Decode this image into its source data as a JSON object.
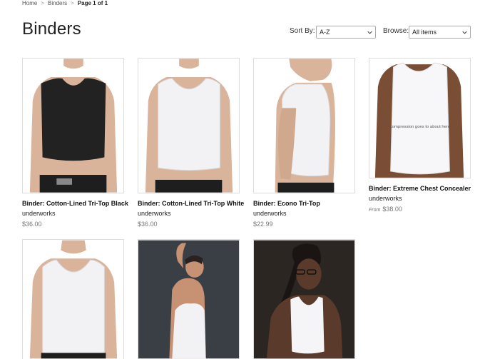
{
  "breadcrumb": {
    "home": "Home",
    "sep": ">",
    "section": "Binders",
    "page": "Page 1 of 1"
  },
  "page_title": "Binders",
  "sort": {
    "label": "Sort By:",
    "value": "A-Z"
  },
  "browse": {
    "label": "Browse:",
    "value": "All items"
  },
  "products": [
    {
      "name": "Binder: Cotton-Lined Tri-Top Black",
      "brand": "underworks",
      "price": "$36.00",
      "from": ""
    },
    {
      "name": "Binder: Cotton-Lined Tri-Top White",
      "brand": "underworks",
      "price": "$36.00",
      "from": ""
    },
    {
      "name": "Binder: Econo Tri-Top",
      "brand": "underworks",
      "price": "$22.99",
      "from": ""
    },
    {
      "name": "Binder: Extreme Chest Concealer",
      "brand": "underworks",
      "price": "$38.00",
      "from": "From",
      "image_caption": "compression goes to about here"
    }
  ],
  "colors": {
    "skin": "#d9b49a",
    "skin_dark": "#7a4e34",
    "black_top": "#222222",
    "white_top": "#f2f2f4",
    "dark_bg": "#3a3f45",
    "darker_bg": "#2b2622"
  }
}
